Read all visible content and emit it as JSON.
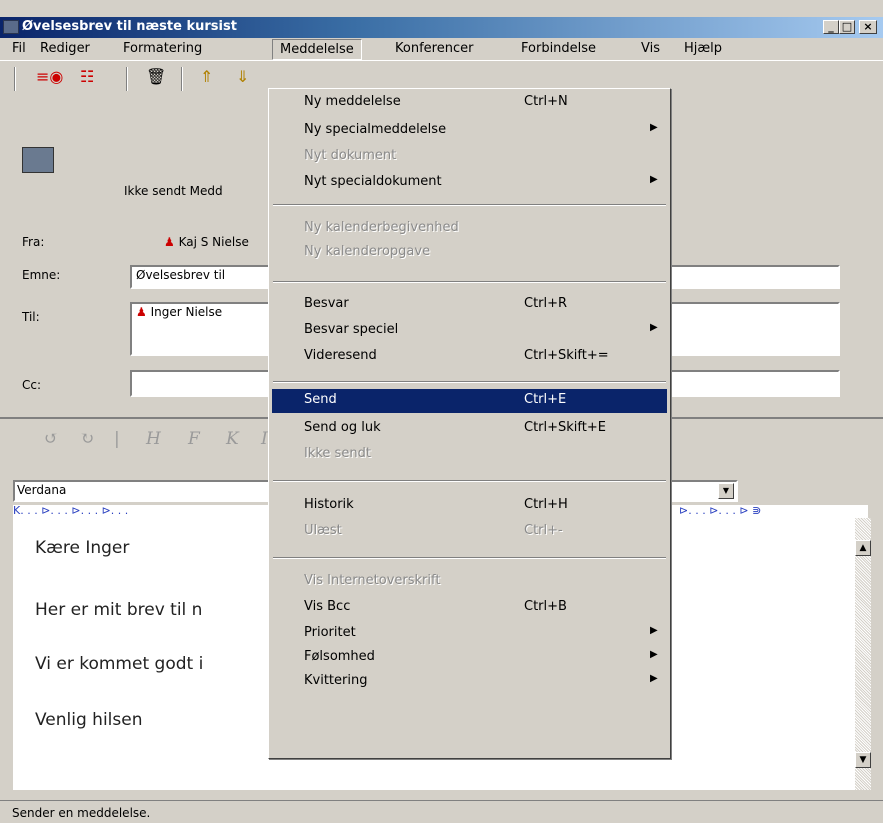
{
  "window": {
    "title": "Øvelsesbrev til næste kursist",
    "min_glyph": "_",
    "max_glyph": "□",
    "close_glyph": "×"
  },
  "menubar": [
    "Fil",
    "Rediger",
    "Formatering",
    "Meddelelse",
    "Konferencer",
    "Forbindelse",
    "Vis",
    "Hjælp"
  ],
  "header": {
    "status_text": "Ikke sendt Medd",
    "from_label": "Fra:",
    "from_value": "Kaj S Nielse",
    "subject_label": "Emne:",
    "subject_value": "Øvelsesbrev til",
    "to_label": "Til:",
    "to_value": "Inger Nielse",
    "cc_label": "Cc:"
  },
  "format": {
    "buttons": [
      "↺",
      "↻",
      "|",
      "H",
      "F",
      "K",
      "I"
    ],
    "font_name": "Verdana",
    "ruler": "K. . . ⊳. . . ⊳. . . ⊳. . ."
  },
  "ruler_right": "⊳. . . ⊳. . . ⊳ ⋑",
  "body_lines": [
    "Kære Inger",
    "Her er mit brev til n",
    "Vi er kommet godt i",
    "Venlig hilsen"
  ],
  "menu": {
    "items": [
      {
        "label": "Ny meddelelse",
        "shortcut": "Ctrl+N",
        "disabled": false,
        "submenu": false
      },
      {
        "label": "Ny specialmeddelelse",
        "shortcut": "",
        "disabled": false,
        "submenu": true
      },
      {
        "label": "Nyt dokument",
        "shortcut": "",
        "disabled": true,
        "submenu": false
      },
      {
        "label": "Nyt specialdokument",
        "shortcut": "",
        "disabled": false,
        "submenu": true
      },
      {
        "label": "Ny kalenderbegivenhed",
        "shortcut": "",
        "disabled": true,
        "submenu": false
      },
      {
        "label": "Ny kalenderopgave",
        "shortcut": "",
        "disabled": true,
        "submenu": false
      },
      {
        "label": "Besvar",
        "shortcut": "Ctrl+R",
        "disabled": false,
        "submenu": false
      },
      {
        "label": "Besvar speciel",
        "shortcut": "",
        "disabled": false,
        "submenu": true
      },
      {
        "label": "Videresend",
        "shortcut": "Ctrl+Skift+=",
        "disabled": false,
        "submenu": false
      },
      {
        "label": "Send",
        "shortcut": "Ctrl+E",
        "disabled": false,
        "submenu": false,
        "selected": true
      },
      {
        "label": "Send og luk",
        "shortcut": "Ctrl+Skift+E",
        "disabled": false,
        "submenu": false
      },
      {
        "label": "Ikke sendt",
        "shortcut": "",
        "disabled": true,
        "submenu": false
      },
      {
        "label": "Historik",
        "shortcut": "Ctrl+H",
        "disabled": false,
        "submenu": false
      },
      {
        "label": "Ulæst",
        "shortcut": "Ctrl+-",
        "disabled": true,
        "submenu": false
      },
      {
        "label": "Vis Internetoverskrift",
        "shortcut": "",
        "disabled": true,
        "submenu": false
      },
      {
        "label": "Vis Bcc",
        "shortcut": "Ctrl+B",
        "disabled": false,
        "submenu": false
      },
      {
        "label": "Prioritet",
        "shortcut": "",
        "disabled": false,
        "submenu": true
      },
      {
        "label": "Følsomhed",
        "shortcut": "",
        "disabled": false,
        "submenu": true
      },
      {
        "label": "Kvittering",
        "shortcut": "",
        "disabled": false,
        "submenu": true
      }
    ],
    "arrow": "▶"
  },
  "statusbar": "Sender en meddelelse.",
  "colors": {
    "titlebar": "#0a246a",
    "selection": "#0a246a",
    "face": "#d4d0c8"
  }
}
